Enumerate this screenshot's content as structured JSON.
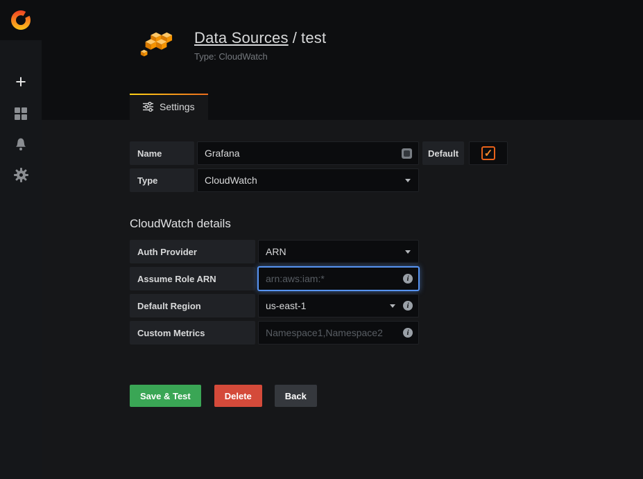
{
  "app": {
    "name": "Grafana"
  },
  "sidebar": {
    "items": [
      {
        "id": "create",
        "icon": "plus-icon"
      },
      {
        "id": "dashboards",
        "icon": "dashboards-icon"
      },
      {
        "id": "alerting",
        "icon": "bell-icon"
      },
      {
        "id": "configuration",
        "icon": "gear-icon"
      }
    ]
  },
  "header": {
    "title_link": "Data Sources",
    "separator": "/",
    "title_current": "test",
    "subtitle": "Type: CloudWatch"
  },
  "tabs": [
    {
      "label": "Settings",
      "icon": "sliders-icon",
      "active": true
    }
  ],
  "form": {
    "name": {
      "label": "Name",
      "value": "Grafana"
    },
    "default": {
      "label": "Default",
      "checked": true
    },
    "type": {
      "label": "Type",
      "value": "CloudWatch"
    },
    "section_title": "CloudWatch details",
    "auth_provider": {
      "label": "Auth Provider",
      "value": "ARN"
    },
    "assume_role": {
      "label": "Assume Role ARN",
      "placeholder": "arn:aws:iam:*"
    },
    "default_region": {
      "label": "Default Region",
      "value": "us-east-1"
    },
    "custom_metrics": {
      "label": "Custom Metrics",
      "placeholder": "Namespace1,Namespace2"
    }
  },
  "actions": {
    "save": "Save & Test",
    "delete": "Delete",
    "back": "Back"
  },
  "icons": {
    "plus_glyph": "+",
    "check_glyph": "✓",
    "info_glyph": "i"
  },
  "colors": {
    "accent_orange": "#eb6c1c",
    "save_green": "#3aa655",
    "delete_red": "#d44a3a",
    "back_gray": "#35383d",
    "focus_blue": "#5794f2"
  }
}
